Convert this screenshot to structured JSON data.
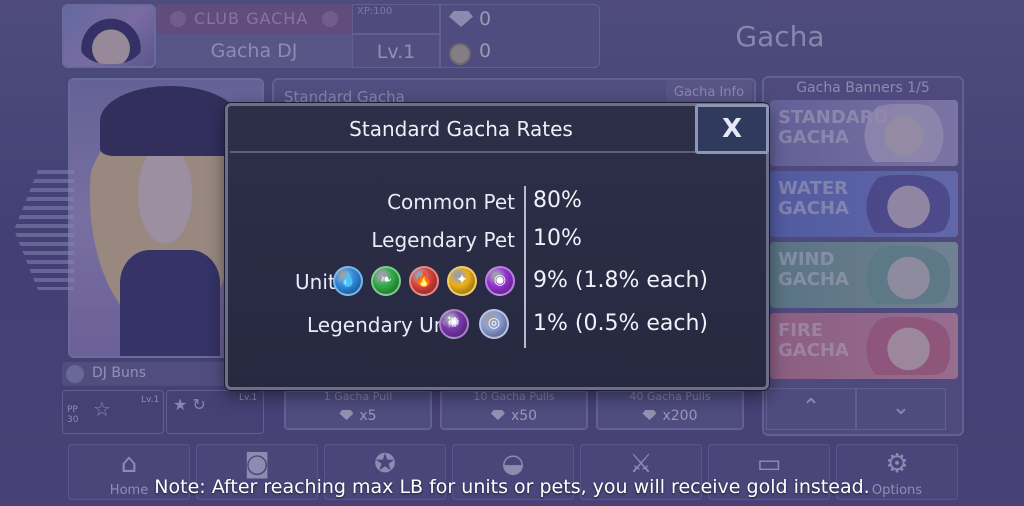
{
  "header": {
    "club_label": "CLUB GACHA",
    "player_name": "Gacha DJ",
    "xp_label": "XP:100",
    "level": "Lv.1",
    "gems": "0",
    "gold": "0",
    "page_title": "Gacha"
  },
  "character": {
    "name": "DJ Buns",
    "pp": "PP\n30",
    "level": "Lv.1",
    "level2": "Lv.1"
  },
  "gacha": {
    "banner_name": "Standard Gacha",
    "info_button": "Gacha Info",
    "pulls": [
      {
        "top": "1 Gacha Pull",
        "cost": "x5"
      },
      {
        "top": "10 Gacha Pulls",
        "cost": "x50"
      },
      {
        "top": "40 Gacha Pulls",
        "cost": "x200"
      }
    ]
  },
  "banners": {
    "title": "Gacha Banners 1/5",
    "items": [
      {
        "label": "STANDARD GACHA"
      },
      {
        "label": "WATER GACHA"
      },
      {
        "label": "WIND GACHA"
      },
      {
        "label": "FIRE GACHA"
      }
    ]
  },
  "nav": [
    {
      "label": "Home",
      "icon": "home-icon"
    },
    {
      "label": "",
      "icon": "camera-icon"
    },
    {
      "label": "",
      "icon": "star-icon"
    },
    {
      "label": "",
      "icon": "gacha-ball-icon"
    },
    {
      "label": "",
      "icon": "swords-icon"
    },
    {
      "label": "",
      "icon": "gamepad-icon"
    },
    {
      "label": "Options",
      "icon": "gear-icon"
    }
  ],
  "modal": {
    "title": "Standard Gacha Rates",
    "close_label": "X",
    "rows": [
      {
        "label": "Common Pet",
        "value": "80%"
      },
      {
        "label": "Legendary Pet",
        "value": "10%"
      },
      {
        "label": "Unit",
        "value": "9% (1.8% each)"
      },
      {
        "label": "Legendary Unit",
        "value": "1% (0.5% each)"
      }
    ],
    "unit_orbs": [
      {
        "name": "water-orb-icon",
        "color": "#2f8fe6",
        "glyph": "💧"
      },
      {
        "name": "wind-orb-icon",
        "color": "#34b24a",
        "glyph": "❧"
      },
      {
        "name": "fire-orb-icon",
        "color": "#e0453c",
        "glyph": "🔥"
      },
      {
        "name": "light-orb-icon",
        "color": "#f0b419",
        "glyph": "✦"
      },
      {
        "name": "dark-orb-icon",
        "color": "#9a35d6",
        "glyph": "◉"
      }
    ],
    "legendary_orbs": [
      {
        "name": "legendary-dark-orb-icon",
        "color": "#7e3bb3",
        "glyph": "✺"
      },
      {
        "name": "legendary-light-orb-icon",
        "color": "#8fa2d9",
        "glyph": "◎"
      }
    ]
  },
  "note": "Note: After reaching max LB for units or pets, you will receive gold instead."
}
